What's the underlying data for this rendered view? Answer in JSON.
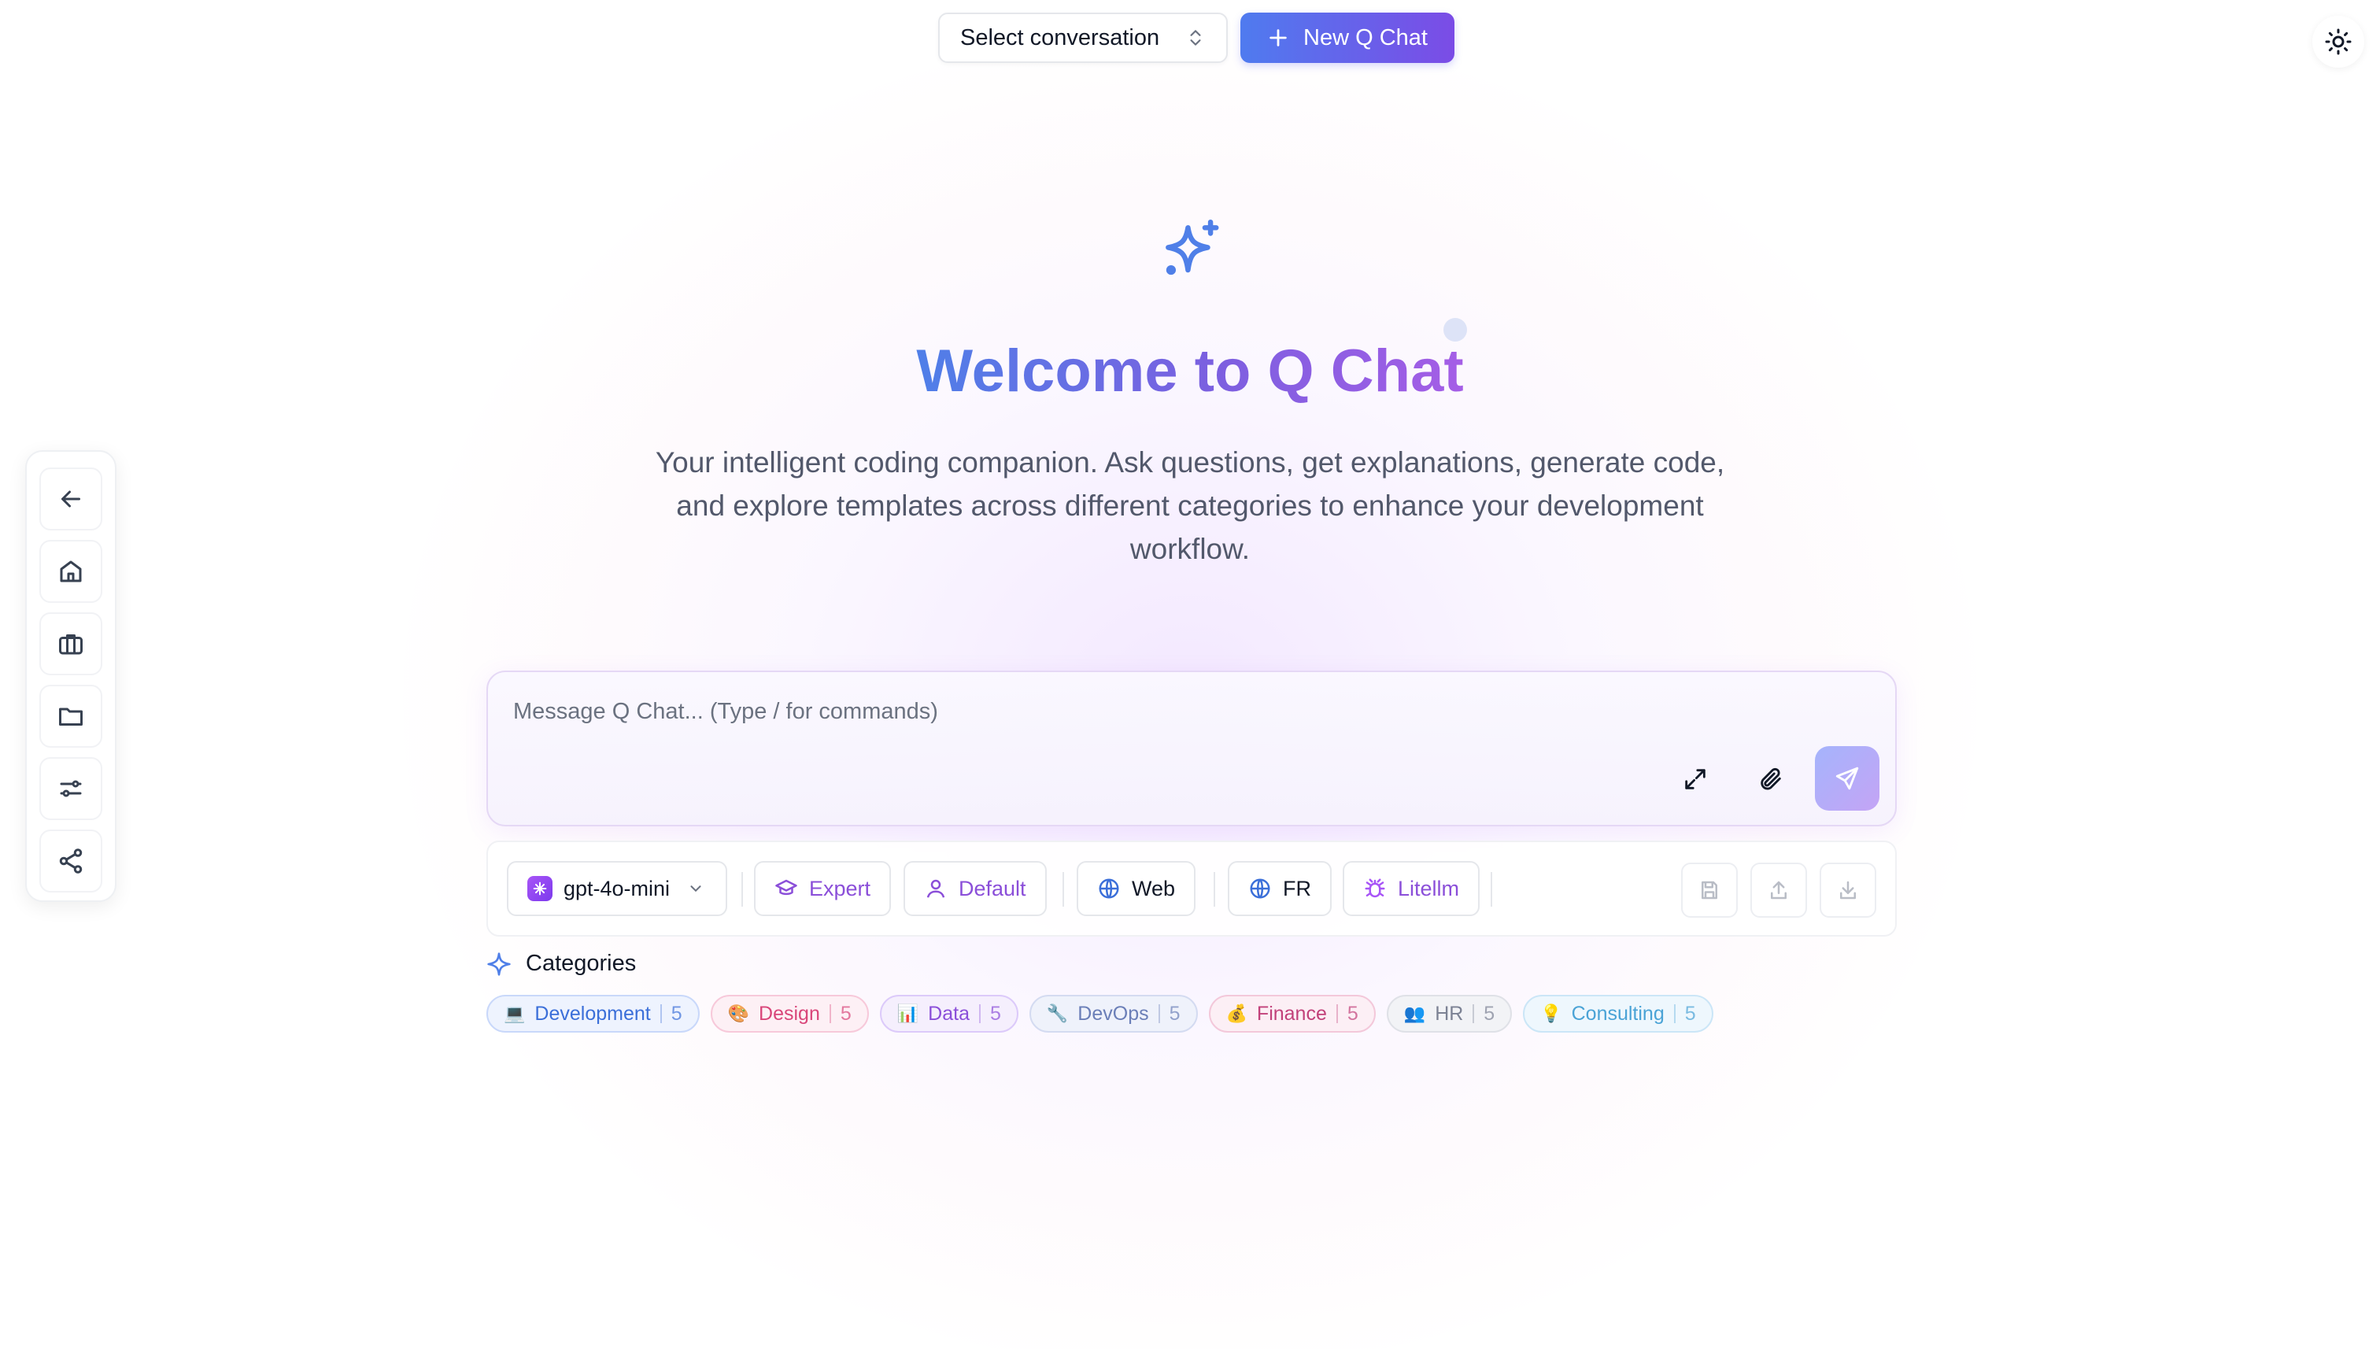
{
  "header": {
    "conversation_select": "Select conversation",
    "new_chat_label": "New Q Chat"
  },
  "hero": {
    "title": "Welcome to Q Chat",
    "subtitle": "Your intelligent coding companion. Ask questions, get explanations, generate code, and explore templates across different categories to enhance your development workflow."
  },
  "composer": {
    "placeholder": "Message Q Chat... (Type / for commands)"
  },
  "toolbar": {
    "model": "gpt-4o-mini",
    "mode": "Expert",
    "persona": "Default",
    "web": "Web",
    "language": "FR",
    "provider": "Litellm"
  },
  "categories": {
    "heading": "Categories",
    "items": [
      {
        "emoji": "💻",
        "label": "Development",
        "count": "5",
        "color": "#3b6fd9",
        "bg": "#eef3fe",
        "border": "#c9d8fa"
      },
      {
        "emoji": "🎨",
        "label": "Design",
        "count": "5",
        "color": "#d9467a",
        "bg": "#fdf0f5",
        "border": "#f7c9da"
      },
      {
        "emoji": "📊",
        "label": "Data",
        "count": "5",
        "color": "#8b4fd9",
        "bg": "#f5effd",
        "border": "#dccafa"
      },
      {
        "emoji": "🔧",
        "label": "DevOps",
        "count": "5",
        "color": "#6b7fb8",
        "bg": "#eff2fb",
        "border": "#d4dbf1"
      },
      {
        "emoji": "💰",
        "label": "Finance",
        "count": "5",
        "color": "#c2417a",
        "bg": "#fceff5",
        "border": "#f3c8da"
      },
      {
        "emoji": "👥",
        "label": "HR",
        "count": "5",
        "color": "#7c8294",
        "bg": "#f2f3f6",
        "border": "#dfe1e7"
      },
      {
        "emoji": "💡",
        "label": "Consulting",
        "count": "5",
        "color": "#4aa3d6",
        "bg": "#eef7fd",
        "border": "#cbe6f7"
      }
    ]
  },
  "colors": {
    "accent_blue": "#4f7bef",
    "accent_purple": "#7b4ce6"
  }
}
